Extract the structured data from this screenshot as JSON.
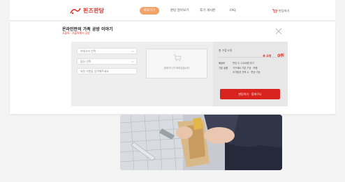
{
  "header": {
    "logo_text": "핀즈판당",
    "nav_active": "바로가기",
    "nav_items": [
      "판당 알아보기",
      "후기 게시판",
      "FAQ"
    ],
    "cart_label": "판당하기"
  },
  "modal": {
    "title": "온라인판의 가족 공방 이야기",
    "subtitle": "서울특 · 서울특별시 공방",
    "select_1": "카테고리 선택",
    "select_2": "옵션 선택",
    "memo_placeholder": "요청 사항을 입력해주세요",
    "cart_empty_text": "장바구니가 비어있습니다",
    "summary_label": "총 수량 0개",
    "total_label": "총 금액",
    "total_value": "0원",
    "info_rows": [
      {
        "key": "배송비",
        "value": "판당 수 1,000원 추가"
      },
      {
        "key": "기본 상품",
        "value": "가구세트 기본 구성 · 포함"
      },
      {
        "key": "",
        "value": "추가옵션 선택 시 · 판당 가능"
      }
    ],
    "order_button": "판당하기 · 장바구니"
  },
  "colors": {
    "brand_red": "#d9231f",
    "nav_pill": "#f0a36a"
  }
}
